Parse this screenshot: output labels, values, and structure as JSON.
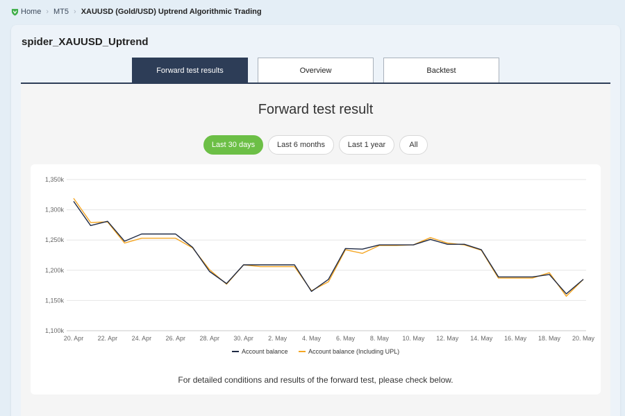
{
  "breadcrumb": {
    "logo_icon": "shield-logo-icon",
    "items": [
      "Home",
      "MT5",
      "XAUUSD (Gold/USD) Uptrend Algorithmic Trading"
    ],
    "separator": "›"
  },
  "ea": {
    "title": "spider_XAUUSD_Uptrend"
  },
  "tabs": [
    {
      "label": "Forward test results",
      "active": true
    },
    {
      "label": "Overview",
      "active": false
    },
    {
      "label": "Backtest",
      "active": false
    }
  ],
  "forward": {
    "heading": "Forward test result",
    "ranges": [
      {
        "label": "Last 30 days",
        "active": true
      },
      {
        "label": "Last 6 months",
        "active": false
      },
      {
        "label": "Last 1 year",
        "active": false
      },
      {
        "label": "All",
        "active": false
      }
    ],
    "footnote": "For detailed conditions and results of the forward test, please check below."
  },
  "colors": {
    "accent_green": "#6cbf46",
    "navy": "#2d3d57",
    "series_balance": "#1f2a44",
    "series_upl": "#f5a623"
  },
  "chart_data": {
    "type": "line",
    "x": [
      "20. Apr",
      "21. Apr",
      "22. Apr",
      "23. Apr",
      "24. Apr",
      "25. Apr",
      "26. Apr",
      "27. Apr",
      "28. Apr",
      "29. Apr",
      "30. Apr",
      "1. May",
      "2. May",
      "3. May",
      "4. May",
      "5. May",
      "6. May",
      "7. May",
      "8. May",
      "9. May",
      "10. May",
      "11. May",
      "12. May",
      "13. May",
      "14. May",
      "15. May",
      "16. May",
      "17. May",
      "18. May",
      "19. May",
      "20. May"
    ],
    "x_tick_labels": [
      "20. Apr",
      "22. Apr",
      "24. Apr",
      "26. Apr",
      "28. Apr",
      "30. Apr",
      "2. May",
      "4. May",
      "6. May",
      "8. May",
      "10. May",
      "12. May",
      "14. May",
      "16. May",
      "18. May",
      "20. May"
    ],
    "y_tick_labels": [
      "1,350k",
      "1,300k",
      "1,250k",
      "1,200k",
      "1,150k",
      "1,100k"
    ],
    "ylim": [
      1100000,
      1350000
    ],
    "grid": true,
    "legend_position": "bottom",
    "series": [
      {
        "name": "Account balance",
        "color": "#1f2a44",
        "values": [
          1314000,
          1274000,
          1281000,
          1248000,
          1260000,
          1260000,
          1260000,
          1238000,
          1198000,
          1178000,
          1209000,
          1209000,
          1209000,
          1209000,
          1165000,
          1185000,
          1236000,
          1235000,
          1242000,
          1242000,
          1242000,
          1251000,
          1243000,
          1243000,
          1234000,
          1189000,
          1189000,
          1189000,
          1193000,
          1161000,
          1185000
        ]
      },
      {
        "name": "Account balance (Including UPL)",
        "color": "#f5a623",
        "values": [
          1319000,
          1279000,
          1280000,
          1245000,
          1253000,
          1253000,
          1253000,
          1237000,
          1201000,
          1177000,
          1209000,
          1206000,
          1206000,
          1206000,
          1166000,
          1181000,
          1234000,
          1228000,
          1241000,
          1241000,
          1242000,
          1254000,
          1245000,
          1242000,
          1233000,
          1187000,
          1187000,
          1187000,
          1196000,
          1157000,
          1185000
        ]
      }
    ]
  }
}
